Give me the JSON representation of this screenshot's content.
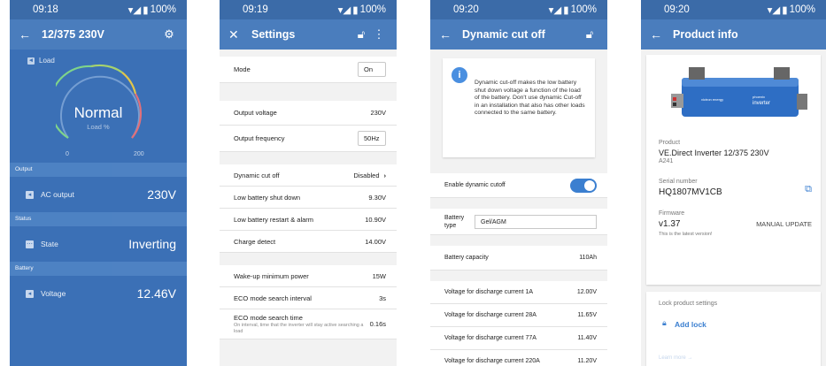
{
  "status_bars": [
    {
      "time": "09:18",
      "battery": "100%"
    },
    {
      "time": "09:19",
      "battery": "100%"
    },
    {
      "time": "09:20",
      "battery": "100%"
    },
    {
      "time": "09:20",
      "battery": "100%"
    }
  ],
  "screen1": {
    "title": "12/375 230V",
    "load_label": "Load",
    "gauge_state": "Normal",
    "gauge_unit": "Load %",
    "gauge_min": "0",
    "gauge_max": "200",
    "sections": [
      {
        "header": "Output",
        "label": "AC output",
        "value": "230V"
      },
      {
        "header": "Status",
        "label": "State",
        "value": "Inverting"
      },
      {
        "header": "Battery",
        "label": "Voltage",
        "value": "12.46V"
      }
    ]
  },
  "screen2": {
    "title": "Settings",
    "rows": [
      {
        "label": "Mode",
        "value": "On"
      },
      {
        "label": "Output voltage",
        "value": "230V"
      },
      {
        "label": "Output frequency",
        "value": "50Hz"
      },
      {
        "label": "Dynamic cut off",
        "value": "Disabled"
      },
      {
        "label": "Low battery shut down",
        "value": "9.30V"
      },
      {
        "label": "Low battery restart & alarm",
        "value": "10.90V"
      },
      {
        "label": "Charge detect",
        "value": "14.00V"
      },
      {
        "label": "Wake-up minimum power",
        "value": "15W"
      },
      {
        "label": "ECO mode search interval",
        "value": "3s"
      },
      {
        "label": "ECO mode search time",
        "value": "0.16s",
        "desc": "On interval, time that the inverter will stay active searching a load"
      }
    ]
  },
  "screen3": {
    "title": "Dynamic cut off",
    "info_text": "Dynamic cut-off makes the low battery shut down voltage a function of the load of the battery. Don't use dynamic Cut-off in an installation that also has other loads connected to the same battery.",
    "enable_label": "Enable dynamic cutoff",
    "battery_type_label": "Battery type",
    "battery_type_value": "Gel/AGM",
    "capacity_label": "Battery capacity",
    "capacity_value": "110Ah",
    "discharge": [
      {
        "label": "Voltage for discharge current 1A",
        "value": "12.00V"
      },
      {
        "label": "Voltage for discharge current 28A",
        "value": "11.65V"
      },
      {
        "label": "Voltage for discharge current 77A",
        "value": "11.40V"
      },
      {
        "label": "Voltage for discharge current 220A",
        "value": "11.20V"
      }
    ]
  },
  "screen4": {
    "title": "Product info",
    "product_label": "Product",
    "product_value": "VE.Direct Inverter 12/375 230V",
    "product_code": "A241",
    "serial_label": "Serial number",
    "serial_value": "HQ1807MV1CB",
    "firmware_label": "Firmware",
    "firmware_value": "v1.37",
    "manual_update": "MANUAL UPDATE",
    "latest_note": "This is the latest version!",
    "lock_title": "Lock product settings",
    "add_lock": "Add lock",
    "learn_more": "Learn more →",
    "device_brand": "victron energy",
    "device_model_line1": "phoenix",
    "device_model_line2": "inverter"
  },
  "colors": {
    "header": "#4a7dbd",
    "statusbar": "#3b6ba8",
    "dashboard_bg": "#3b70b6",
    "accent": "#3b7fd0"
  }
}
